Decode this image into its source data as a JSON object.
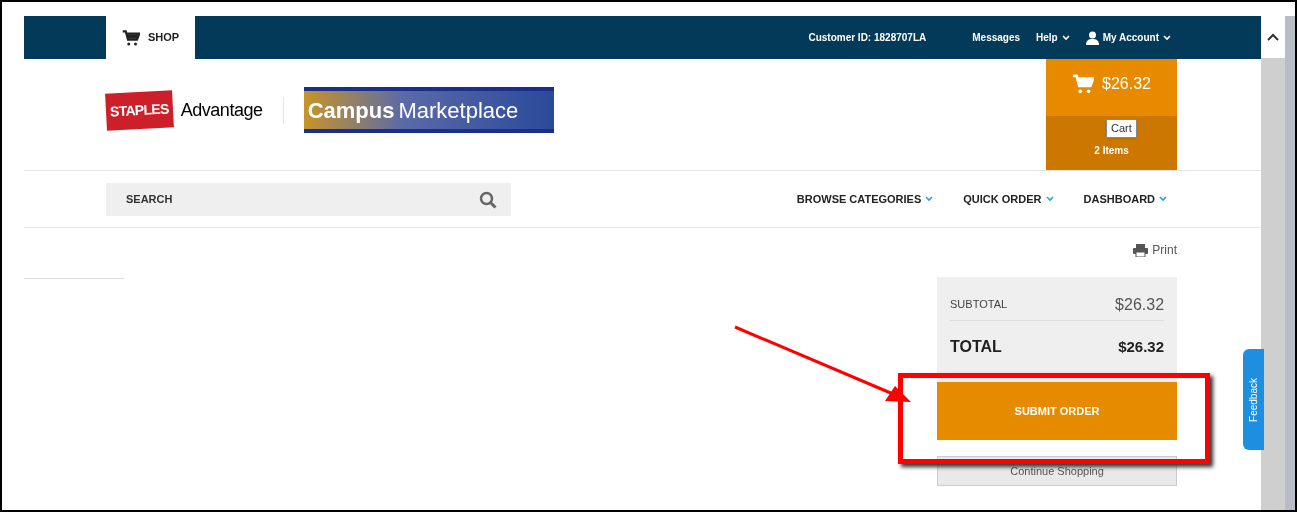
{
  "top_nav": {
    "tabs": [
      {
        "label": "SHOP",
        "selected": true
      }
    ],
    "customer_id": "Customer ID: 1828707LA",
    "links": [
      {
        "label": "Messages",
        "dropdown": false
      },
      {
        "label": "Help",
        "dropdown": true
      },
      {
        "label": "My Account",
        "dropdown": true
      }
    ]
  },
  "logos": {
    "staples": "STAPLES",
    "advantage": "Advantage",
    "campus_bold": "Campus",
    "campus_rest": "Marketplace"
  },
  "cart": {
    "amount": "$26.32",
    "items": "2 Items",
    "tooltip": "Cart"
  },
  "search": {
    "placeholder": "SEARCH"
  },
  "menu": [
    "BROWSE CATEGORIES",
    "QUICK ORDER",
    "DASHBOARD"
  ],
  "print": "Print",
  "summary": {
    "subtotal_label": "SUBTOTAL",
    "subtotal": "$26.32",
    "total_label": "TOTAL",
    "total": "$26.32"
  },
  "submit_button": "SUBMIT ORDER",
  "continue_button": "Continue Shopping",
  "feedback": "Feedback",
  "annotation": {
    "highlight": true
  }
}
